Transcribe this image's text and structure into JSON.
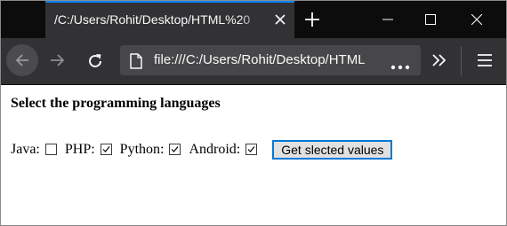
{
  "browser": {
    "tab_title": "/C:/Users/Rohit/Desktop/HTML%20",
    "url": "file:///C:/Users/Rohit/Desktop/HTML",
    "page_actions_label": "•••"
  },
  "page": {
    "heading": "Select the programming languages",
    "languages": [
      {
        "label": "Java:",
        "checked": false
      },
      {
        "label": "PHP:",
        "checked": true
      },
      {
        "label": "Python:",
        "checked": true
      },
      {
        "label": "Android:",
        "checked": true
      }
    ],
    "button_label": "Get slected values"
  },
  "icons": {
    "tab_close": "close-icon",
    "new_tab": "plus-icon",
    "minimize": "minimize-icon",
    "maximize": "maximize-icon",
    "close_window": "close-icon",
    "back": "arrow-left-icon",
    "forward": "arrow-right-icon",
    "reload": "reload-icon",
    "page": "page-icon",
    "overflow": "chevrons-right-icon",
    "menu": "hamburger-icon"
  },
  "colors": {
    "titlebar": "#0c0c0d",
    "toolbar": "#323234",
    "urlbar": "#474749",
    "tab_accent": "#0a84ff",
    "button_focus": "#0078d7"
  }
}
